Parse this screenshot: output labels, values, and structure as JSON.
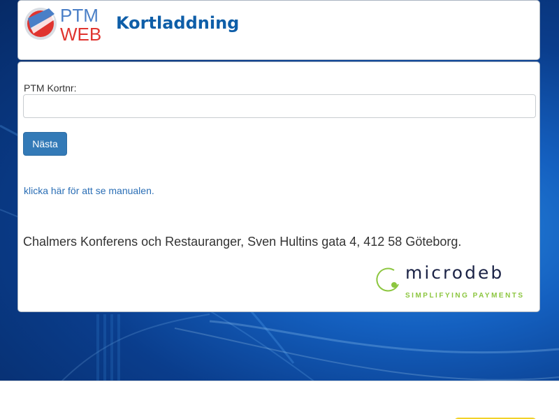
{
  "header": {
    "logo_text_top": "PTM",
    "logo_text_bottom": "WEB",
    "title": "Kortladdning"
  },
  "form": {
    "card_label": "PTM Kortnr:",
    "card_value": "",
    "next_button": "Nästa"
  },
  "manual_link": "klicka här för att se manualen.",
  "address": "Chalmers Konferens och Restauranger, Sven Hultins gata 4, 412 58 Göteborg.",
  "brand": {
    "name": "microdeb",
    "tagline": "SIMPLIFYING PAYMENTS"
  },
  "colors": {
    "title_blue": "#0e5ea8",
    "button_blue": "#337ab7",
    "link_blue": "#2a6eb5",
    "logo_red": "#e0342f",
    "brand_green": "#8cc63f",
    "brand_navy": "#1b2346"
  }
}
